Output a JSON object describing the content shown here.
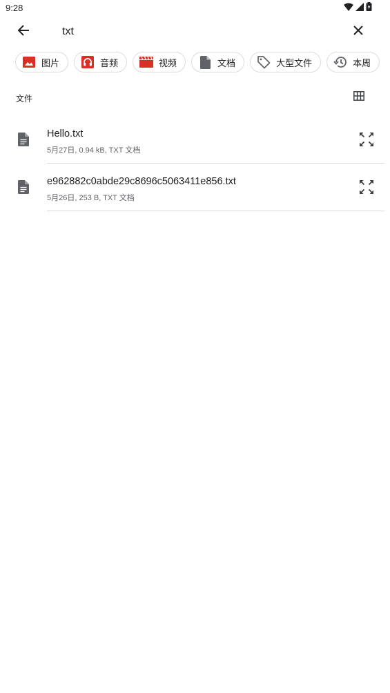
{
  "status_bar": {
    "time": "9:28"
  },
  "search": {
    "query": "txt"
  },
  "chips": [
    {
      "label": "图片",
      "icon": "image-icon",
      "color": "#d93025"
    },
    {
      "label": "音频",
      "icon": "headphones-icon",
      "color": "#d93025"
    },
    {
      "label": "视频",
      "icon": "video-icon",
      "color": "#d93025"
    },
    {
      "label": "文档",
      "icon": "document-icon",
      "color": "#5f6368"
    },
    {
      "label": "大型文件",
      "icon": "tag-icon",
      "color": "#5f6368"
    },
    {
      "label": "本周",
      "icon": "history-icon",
      "color": "#5f6368"
    }
  ],
  "section": {
    "title": "文件"
  },
  "files": [
    {
      "name": "Hello.txt",
      "meta": "5月27日, 0.94 kB, TXT 文档"
    },
    {
      "name": "e962882c0abde29c8696c5063411e856.txt",
      "meta": "5月26日, 253 B, TXT 文档"
    }
  ]
}
